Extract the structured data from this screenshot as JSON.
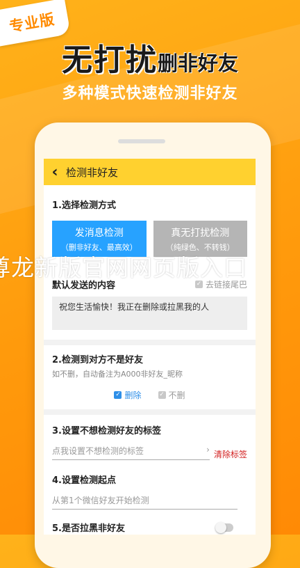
{
  "promo": {
    "badge": "专业版",
    "headline_big": "无打扰",
    "headline_small": "删非好友",
    "subtitle": "多种模式快速检测非好友"
  },
  "app": {
    "title": "检测非好友",
    "back_icon": "chevron-left-icon",
    "accent": "#ffd12f"
  },
  "section1": {
    "title": "1.选择检测方式",
    "mode_send": {
      "label": "发消息检测",
      "sub": "（删非好友、最高效）",
      "color": "#27a2ff",
      "selected": true
    },
    "mode_quiet": {
      "label": "真无打扰检测",
      "sub": "（纯绿色、不转钱）",
      "color": "#b5b5b5",
      "selected": false
    },
    "default_label": "默认发送的内容",
    "tail_label": "去链接尾巴",
    "tail_checked": true,
    "message": "祝您生活愉快！我正在删除或拉黑我的人"
  },
  "section2": {
    "title": "2.检测到对方不是好友",
    "hint": "如不删，自动备注为A000非好友_昵称",
    "delete_label": "删除",
    "delete_checked": true,
    "keep_label": "不删",
    "keep_checked": true
  },
  "section3": {
    "title": "3.设置不想检测好友的标签",
    "placeholder": "点我设置不想检测的标签",
    "clear_label": "清除标签"
  },
  "section4": {
    "title": "4.设置检测起点",
    "placeholder": "从第1个微信好友开始检测"
  },
  "section5": {
    "title": "5.是否拉黑非好友",
    "toggle_on": false
  },
  "watermark": "尊龙新版官网网页版入口"
}
